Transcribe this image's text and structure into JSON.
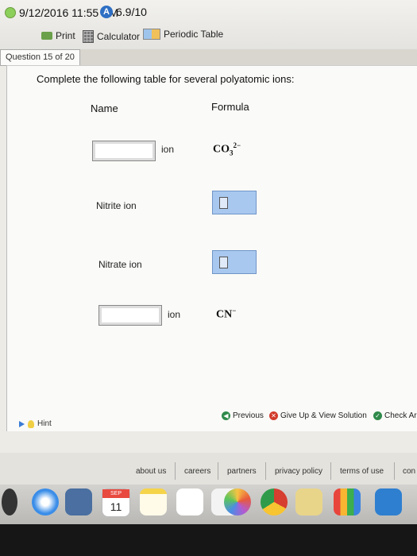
{
  "header": {
    "datetime": "9/12/2016 11:55 PM",
    "score": "6.9/10",
    "score_icon_letter": "A",
    "tools": {
      "print": "Print",
      "calculator": "Calculator",
      "periodic_table": "Periodic Table"
    }
  },
  "question_tab": "Question 15 of 20",
  "prompt": "Complete the following table for several polyatomic ions:",
  "table": {
    "headers": {
      "name": "Name",
      "formula": "Formula"
    },
    "rows": [
      {
        "name_suffix": "ion",
        "formula_base": "CO",
        "formula_sub": "3",
        "formula_sup": "2−"
      },
      {
        "name": "Nitrite ion"
      },
      {
        "name": "Nitrate ion"
      },
      {
        "name_suffix": "ion",
        "formula_base": "CN",
        "formula_sup": "−"
      }
    ]
  },
  "nav": {
    "previous": "Previous",
    "give_up": "Give Up & View Solution",
    "check": "Check Ar",
    "hint": "Hint"
  },
  "footer_links": [
    "about us",
    "careers",
    "partners",
    "privacy policy",
    "terms of use",
    "con"
  ],
  "dock": {
    "calendar_month": "SEP",
    "calendar_day": "11"
  }
}
